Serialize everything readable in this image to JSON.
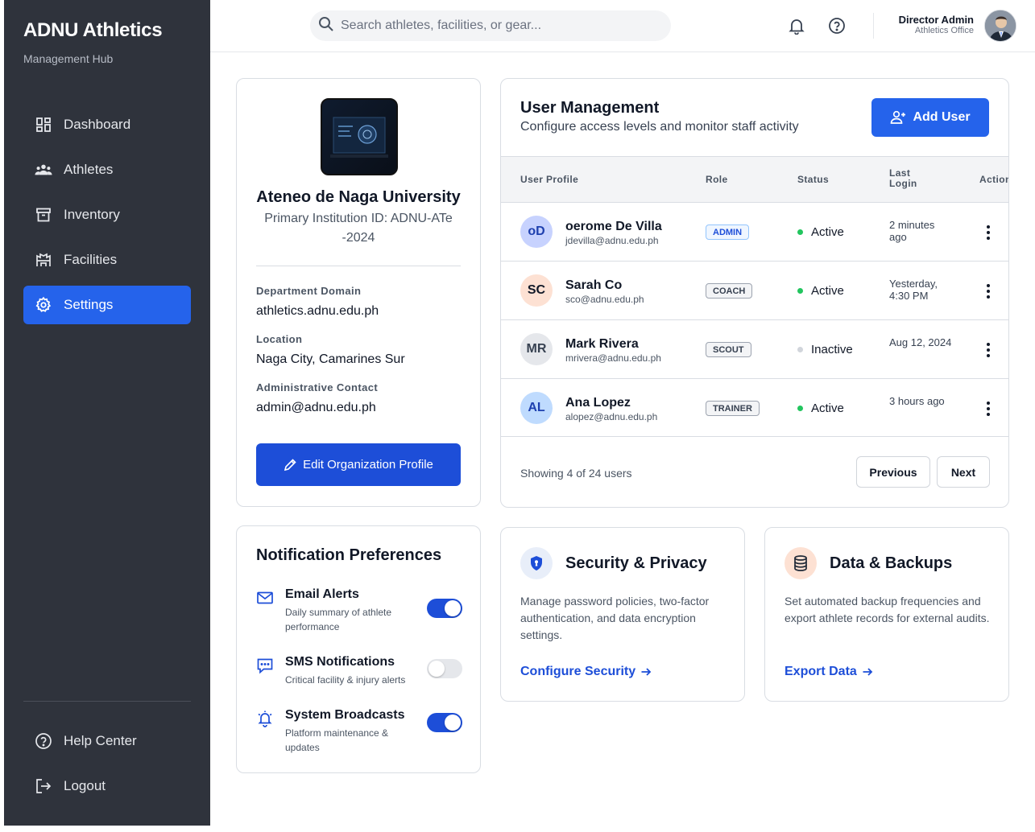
{
  "app": {
    "title": "ADNU Athletics",
    "subtitle": "Management Hub"
  },
  "sidebar": {
    "items": [
      {
        "label": "Dashboard",
        "icon": "dashboard-icon"
      },
      {
        "label": "Athletes",
        "icon": "athletes-icon"
      },
      {
        "label": "Inventory",
        "icon": "inventory-icon"
      },
      {
        "label": "Facilities",
        "icon": "facilities-icon"
      },
      {
        "label": "Settings",
        "icon": "gear-icon",
        "active": true
      }
    ],
    "bottom": [
      {
        "label": "Help Center",
        "icon": "help-icon"
      },
      {
        "label": "Logout",
        "icon": "logout-icon"
      }
    ]
  },
  "header": {
    "search_placeholder": "Search athletes, facilities, or gear...",
    "user_name": "Director Admin",
    "user_role": "Athletics Office"
  },
  "org": {
    "name": "Ateneo de Naga University",
    "id_text": "Primary Institution ID: ADNU-ATe -2024",
    "fields": [
      {
        "label": "Department Domain",
        "value": "athletics.adnu.edu.ph"
      },
      {
        "label": "Location",
        "value": "Naga City, Camarines Sur"
      },
      {
        "label": "Administrative Contact",
        "value": "admin@adnu.edu.ph"
      }
    ],
    "edit_button": "Edit Organization Profile"
  },
  "users": {
    "title": "User Management",
    "subtitle": "Configure access levels and monitor staff activity",
    "add_button": "Add User",
    "columns": [
      "User Profile",
      "Role",
      "Status",
      "Last Login",
      "Actions"
    ],
    "rows": [
      {
        "initials": "oD",
        "name": "oerome De Villa",
        "email": "jdevilla@adnu.edu.ph",
        "role": "ADMIN",
        "status": "Active",
        "last_login": "2 minutes ago",
        "avatar_bg": "#c7d2fe",
        "avatar_fg": "#1e40af"
      },
      {
        "initials": "SC",
        "name": "Sarah Co",
        "email": "sco@adnu.edu.ph",
        "role": "COACH",
        "status": "Active",
        "last_login": "Yesterday, 4:30 PM",
        "avatar_bg": "#fde1d3",
        "avatar_fg": "#111827"
      },
      {
        "initials": "MR",
        "name": "Mark Rivera",
        "email": "mrivera@adnu.edu.ph",
        "role": "SCOUT",
        "status": "Inactive",
        "last_login": "Aug 12, 2024",
        "avatar_bg": "#e5e7eb",
        "avatar_fg": "#374151"
      },
      {
        "initials": "AL",
        "name": "Ana Lopez",
        "email": "alopez@adnu.edu.ph",
        "role": "TRAINER",
        "status": "Active",
        "last_login": "3 hours ago",
        "avatar_bg": "#bfdbfe",
        "avatar_fg": "#1e40af"
      }
    ],
    "showing": "Showing 4 of 24 users",
    "prev": "Previous",
    "next": "Next"
  },
  "notifications": {
    "title": "Notification Preferences",
    "items": [
      {
        "title": "Email Alerts",
        "desc": "Daily summary of athlete performance",
        "enabled": true,
        "icon": "mail-icon"
      },
      {
        "title": "SMS Notifications",
        "desc": "Critical facility & injury alerts",
        "enabled": false,
        "icon": "chat-icon"
      },
      {
        "title": "System Broadcasts",
        "desc": "Platform maintenance & updates",
        "enabled": true,
        "icon": "bell-ring-icon"
      }
    ]
  },
  "security": {
    "title": "Security & Privacy",
    "desc": "Manage password policies, two-factor authentication, and data encryption settings.",
    "link": "Configure Security"
  },
  "backups": {
    "title": "Data & Backups",
    "desc": "Set automated backup frequencies and export athlete records for external audits.",
    "link": "Export Data"
  },
  "colors": {
    "primary": "#2563eb",
    "primary_dark": "#1d4ed8",
    "sidebar": "#2f333c",
    "active_dot": "#22c55e",
    "inactive_dot": "#d1d5db"
  }
}
